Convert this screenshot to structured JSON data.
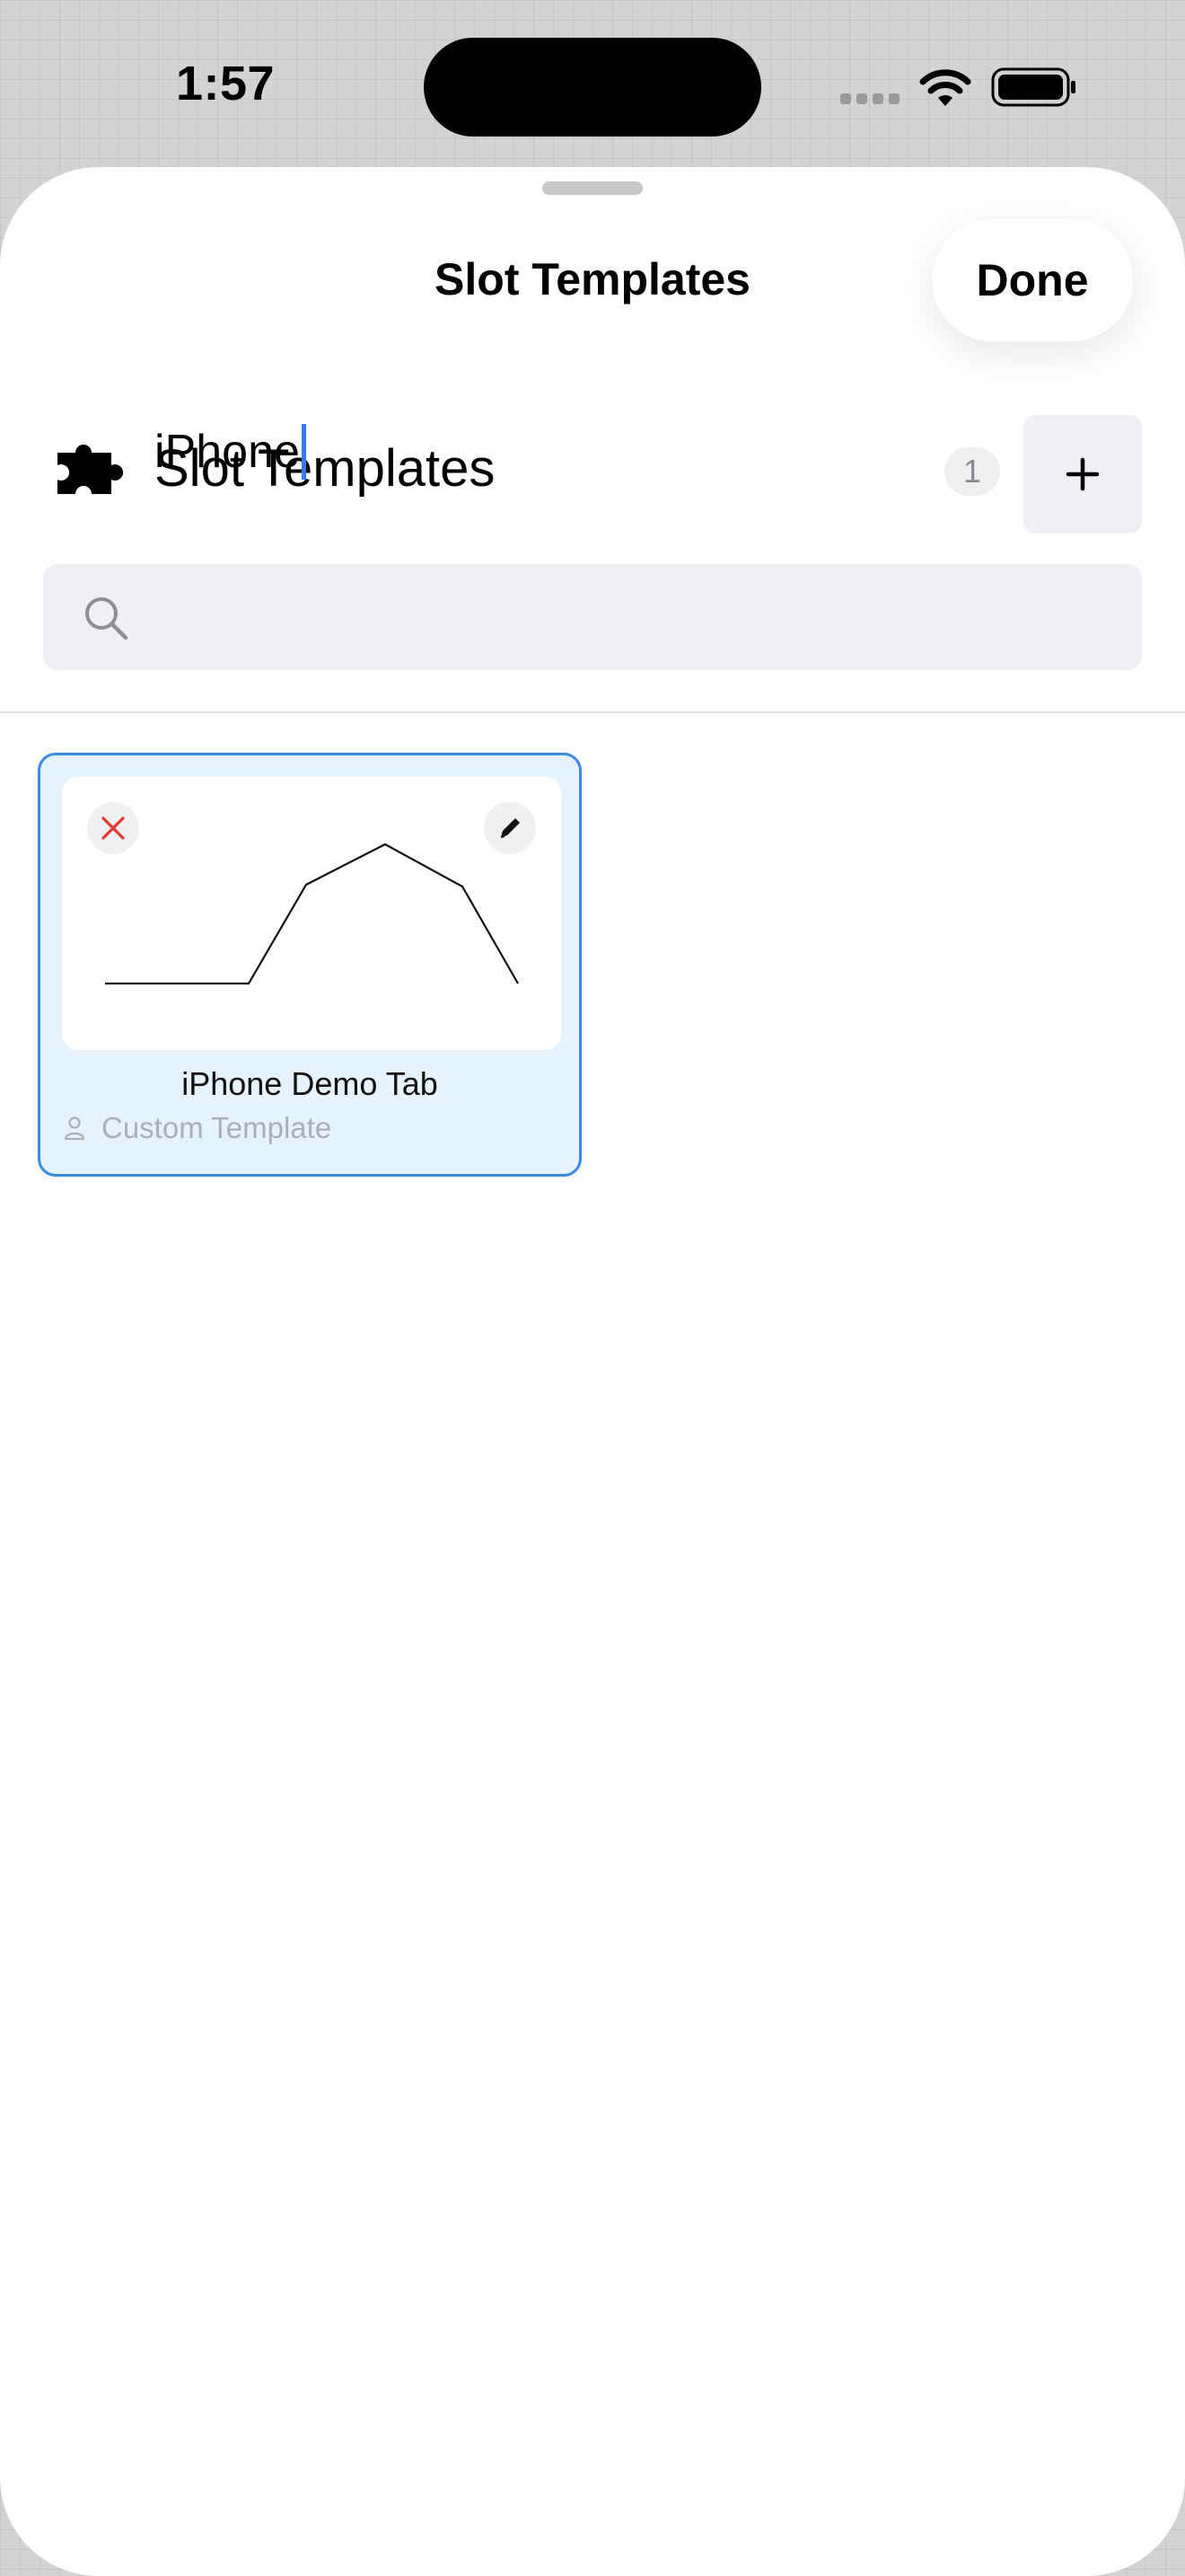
{
  "status_bar": {
    "time": "1:57"
  },
  "sheet": {
    "title": "Slot Templates",
    "done_label": "Done"
  },
  "section": {
    "icon": "puzzle-icon",
    "title": "Slot Templates",
    "count": "1",
    "add_label": "+"
  },
  "search": {
    "icon": "search-icon",
    "value": "iPhone"
  },
  "templates": [
    {
      "name": "iPhone Demo Tab",
      "type": "Custom Template",
      "selected": true,
      "delete_icon": "close-icon",
      "edit_icon": "pencil-icon",
      "type_icon": "person-icon"
    }
  ],
  "colors": {
    "accent": "#3d8be0",
    "selected_card_bg": "#e6f2fd",
    "delete": "#e53935",
    "caret": "#2f7bea"
  }
}
